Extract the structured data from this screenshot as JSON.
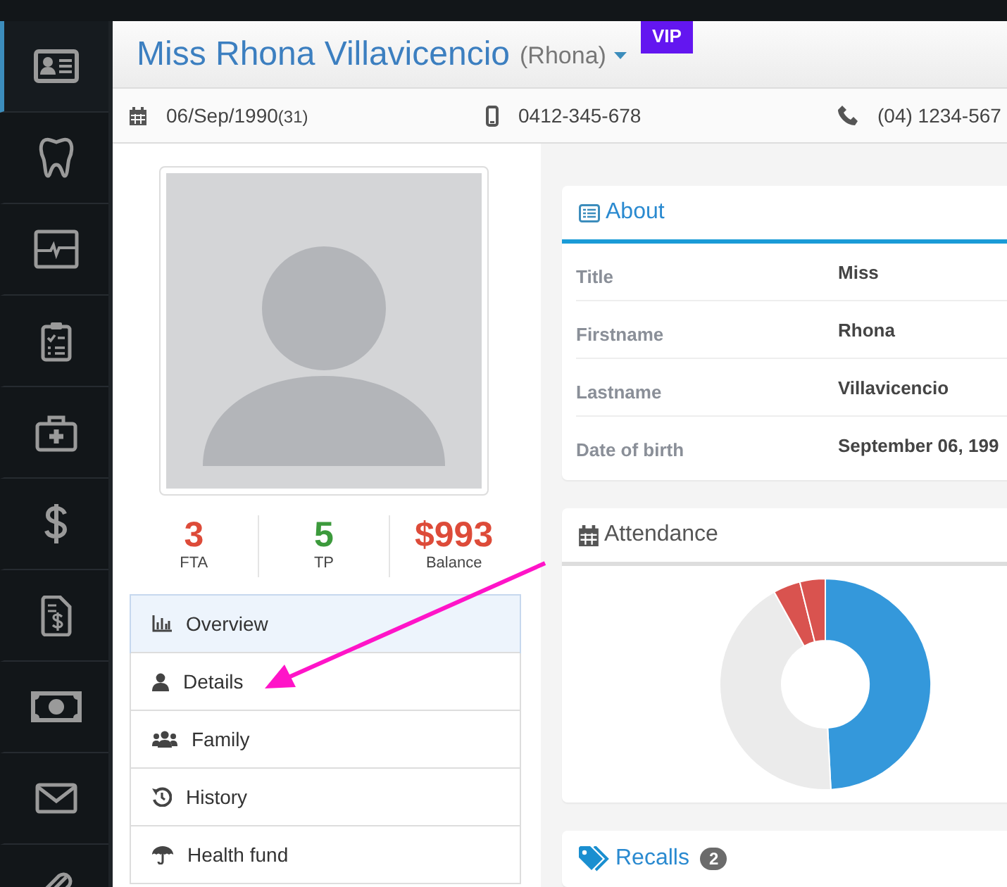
{
  "sidebar": {
    "items": [
      {
        "kind": "id-card",
        "selected": true
      },
      {
        "kind": "tooth",
        "selected": false
      },
      {
        "kind": "monitor",
        "selected": false
      },
      {
        "kind": "clipboard",
        "selected": false
      },
      {
        "kind": "medkit",
        "selected": false
      },
      {
        "kind": "dollar",
        "selected": false
      },
      {
        "kind": "invoice",
        "selected": false
      },
      {
        "kind": "bill",
        "selected": false
      },
      {
        "kind": "envelope",
        "selected": false
      },
      {
        "kind": "paperclip",
        "selected": false
      }
    ]
  },
  "header": {
    "title": "Miss Rhona Villavicencio",
    "nickname": "(Rhona)",
    "badge": "VIP"
  },
  "info": [
    {
      "kind": "birthday",
      "text": "06/Sep/1990",
      "extra": "(31)"
    },
    {
      "kind": "mobile",
      "text": "0412-345-678"
    },
    {
      "kind": "phone",
      "text": "(04) 1234-567"
    }
  ],
  "stats": [
    {
      "value": "3",
      "label": "FTA",
      "color": "#dd4b39"
    },
    {
      "value": "5",
      "label": "TP",
      "color": "#3c9a3c"
    },
    {
      "value": "$993",
      "label": "Balance",
      "color": "#dd4b39"
    }
  ],
  "menu": [
    {
      "kind": "chart",
      "label": "Overview",
      "selected": true
    },
    {
      "kind": "user",
      "label": "Details",
      "selected": false
    },
    {
      "kind": "users",
      "label": "Family",
      "selected": false
    },
    {
      "kind": "history",
      "label": "History",
      "selected": false
    },
    {
      "kind": "umbrella",
      "label": "Health fund",
      "selected": false
    }
  ],
  "about": {
    "title": "About",
    "rows": [
      {
        "label": "Title",
        "value": "Miss"
      },
      {
        "label": "Firstname",
        "value": "Rhona"
      },
      {
        "label": "Lastname",
        "value": "Villavicencio"
      },
      {
        "label": "Date of birth",
        "value": "September 06, 199"
      }
    ]
  },
  "attendance": {
    "title": "Attendance"
  },
  "recalls": {
    "title": "Recalls",
    "count": "2"
  }
}
